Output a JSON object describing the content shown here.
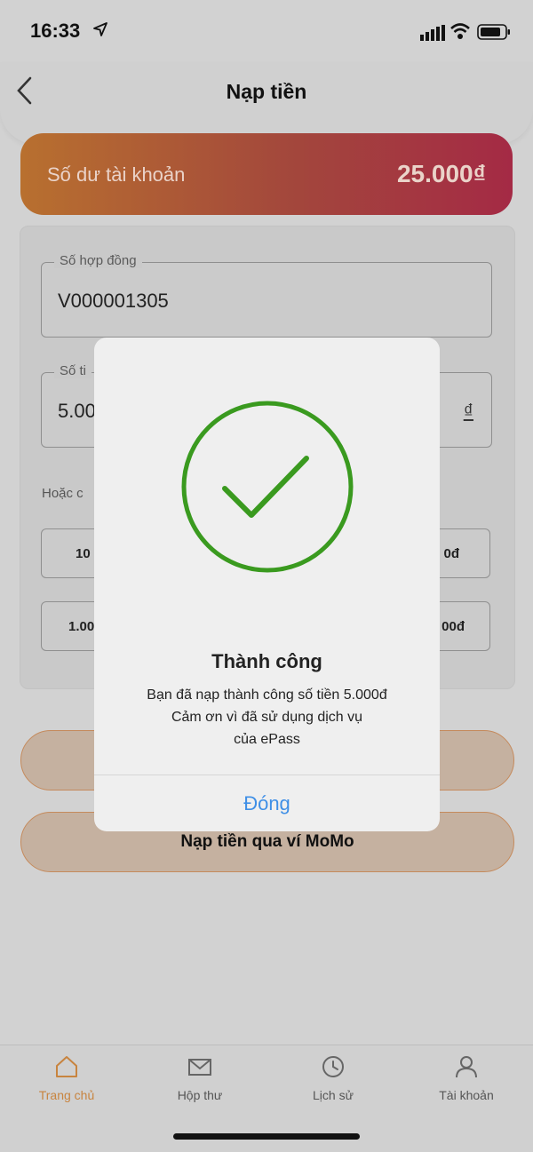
{
  "status_bar": {
    "time": "16:33"
  },
  "header": {
    "title": "Nạp tiền"
  },
  "balance": {
    "label": "Số dư tài khoản",
    "value": "25.000₫"
  },
  "form": {
    "contract_label": "Số hợp đồng",
    "contract_value": "V000001305",
    "amount_label": "Số ti",
    "amount_value": "5.00",
    "currency": "₫",
    "hint": "Hoặc c",
    "chips": [
      "10",
      "0đ",
      "1.00",
      "00đ"
    ]
  },
  "buttons": {
    "momo": "Nạp tiền qua ví MoMo"
  },
  "tabs": [
    {
      "label": "Trang chủ",
      "icon": "home-icon"
    },
    {
      "label": "Hộp thư",
      "icon": "mail-icon"
    },
    {
      "label": "Lịch sử",
      "icon": "clock-icon"
    },
    {
      "label": "Tài khoản",
      "icon": "user-icon"
    }
  ],
  "modal": {
    "title": "Thành công",
    "message_line1": "Bạn đã nạp thành công số tiền 5.000đ",
    "message_line2": "Cảm ơn vì đã sử dụng dịch vụ",
    "message_line3": "của ePass",
    "close_label": "Đóng"
  },
  "colors": {
    "accent_orange": "#c8843f",
    "success_green": "#3a9a1f",
    "link_blue": "#3f8fe6",
    "balance_gradient_start": "#b8702f",
    "balance_gradient_end": "#a42a45"
  }
}
